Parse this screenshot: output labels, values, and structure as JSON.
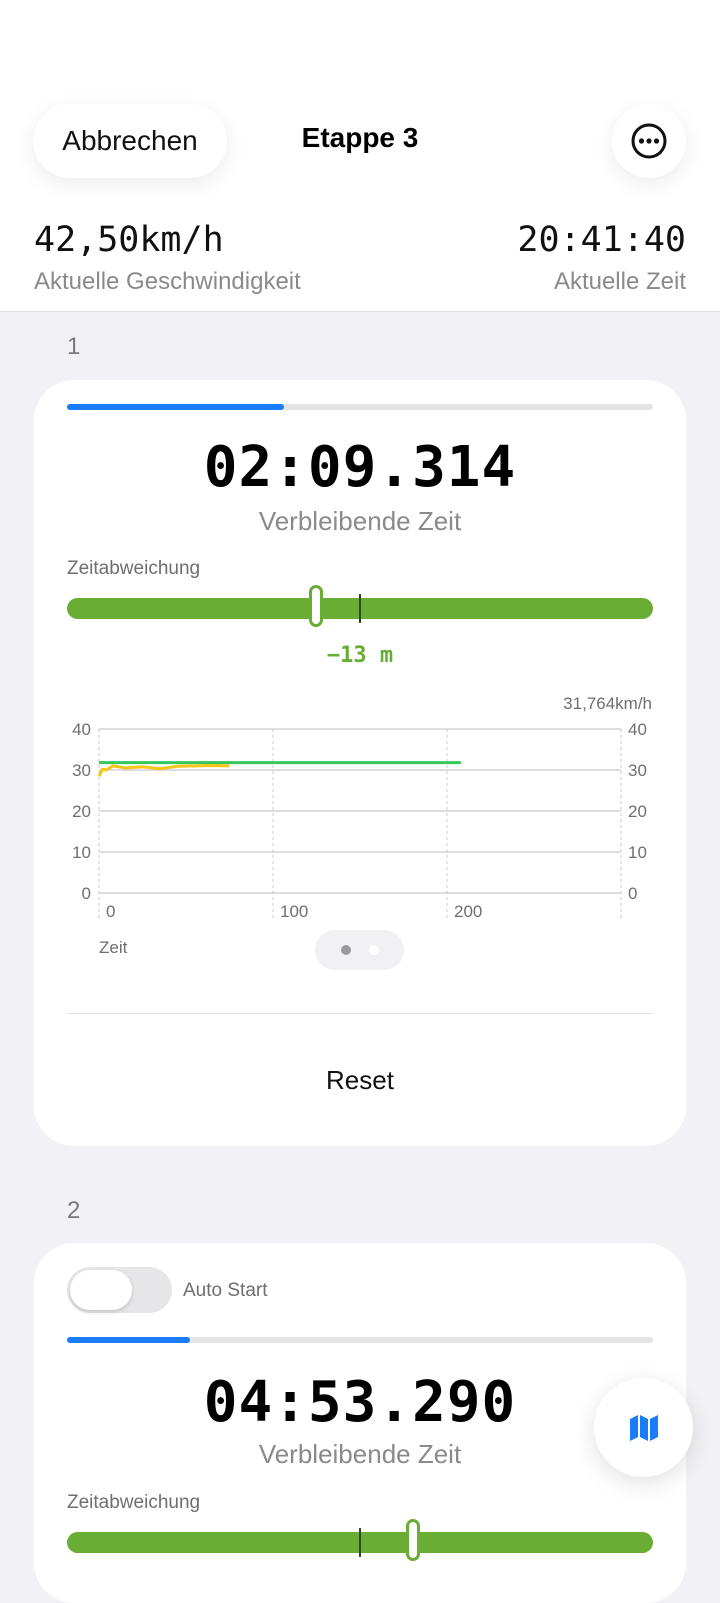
{
  "header": {
    "cancel_label": "Abbrechen",
    "title": "Etappe 3",
    "more_icon": "ellipsis-circle-icon",
    "current_speed_value": "42,50km/h",
    "current_speed_label": "Aktuelle Geschwindigkeit",
    "current_time_value": "20:41:40",
    "current_time_label": "Aktuelle Zeit"
  },
  "stages": [
    {
      "number": "1",
      "progress": 0.37,
      "remaining_time": "02:09.314",
      "remaining_label": "Verbleibende Zeit",
      "deviation_label": "Zeitabweichung",
      "deviation_value": "−13 m",
      "deviation_thumb_position": 0.425,
      "speed_note": "31,764km/h",
      "x_axis_title": "Zeit",
      "pager_dots": 2,
      "pager_active": 0,
      "reset_label": "Reset"
    },
    {
      "number": "2",
      "auto_start_label": "Auto Start",
      "auto_start_on": false,
      "progress": 0.21,
      "remaining_time": "04:53.290",
      "remaining_label": "Verbleibende Zeit",
      "deviation_label": "Zeitabweichung",
      "deviation_thumb_position": 0.59
    }
  ],
  "map_button_icon": "map-icon",
  "colors": {
    "accent_blue": "#1a7cf6",
    "deviation_green": "#6aad35",
    "target_line_green": "#34c759",
    "actual_line_yellow": "#f5c518"
  },
  "chart_data": {
    "type": "line",
    "xlabel": "Zeit",
    "ylabel": "",
    "x_ticks": [
      0,
      100,
      200
    ],
    "y_ticks": [
      0,
      10,
      20,
      30,
      40
    ],
    "xlim": [
      0,
      300
    ],
    "ylim": [
      0,
      40
    ],
    "grid": true,
    "series": [
      {
        "color": "#34c759",
        "x": [
          0,
          208
        ],
        "y": [
          31.8,
          31.8
        ]
      },
      {
        "color": "#f5c518",
        "x": [
          0,
          2,
          4,
          8,
          15,
          25,
          35,
          45,
          55,
          65,
          75
        ],
        "y": [
          28.5,
          30.2,
          30.0,
          31.0,
          30.5,
          30.8,
          30.3,
          30.9,
          31.0,
          31.1,
          31.0
        ]
      }
    ]
  }
}
